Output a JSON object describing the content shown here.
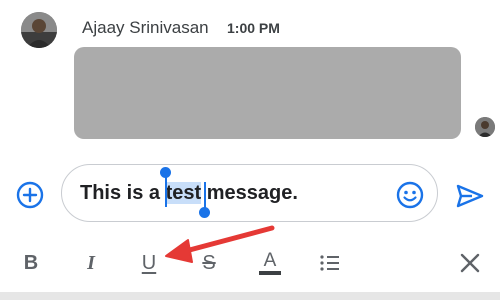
{
  "message": {
    "sender_name": "Ajaay Srinivasan",
    "time": "1:00 PM"
  },
  "compose": {
    "text_before": "This is a ",
    "selected_text": "test",
    "text_after": " message."
  },
  "format_bar": {
    "bold_label": "B",
    "italic_label": "I",
    "underline_label": "U",
    "strikethrough_label": "S",
    "color_label": "A"
  },
  "icons": {
    "add": "plus-circle-icon",
    "emoji": "emoji-icon",
    "send": "send-icon",
    "list": "bulleted-list-icon",
    "close": "close-icon"
  },
  "colors": {
    "accent": "#1a73e8",
    "selection": "#c8def9",
    "annotation_arrow": "#e53935",
    "attachment_placeholder": "#ababab"
  }
}
